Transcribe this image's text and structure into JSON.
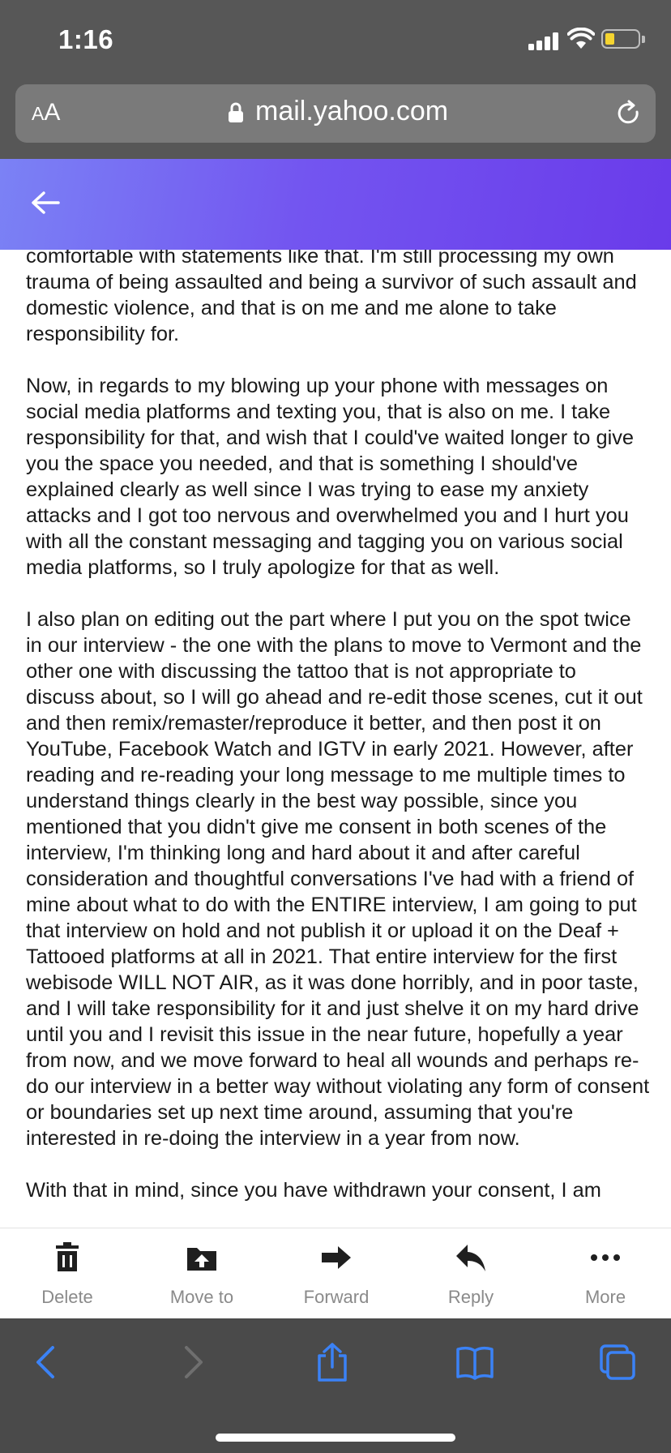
{
  "status_bar": {
    "time": "1:16"
  },
  "browser": {
    "aa_label_small": "A",
    "aa_label_large": "A",
    "url": "mail.yahoo.com"
  },
  "email": {
    "paragraphs": [
      "comfortable with statements like that. I'm still processing my own trauma of being assaulted and being a survivor of such assault and domestic violence, and that is on me and me alone to take responsibility for.",
      "Now, in regards to my blowing up your phone with messages on social media platforms and texting you, that is also on me. I take responsibility for that, and wish that I could've waited longer to give you the space you needed, and that is something I should've explained clearly as well since I was trying to ease my anxiety attacks and I got too nervous and overwhelmed you and I hurt you with all the constant messaging and tagging you on various social media platforms, so I truly apologize for that as well.",
      "I also plan on editing out the part where I put you on the spot twice in our interview - the one with the plans to move to Vermont and the other one with discussing the tattoo that is not appropriate to discuss about, so I will go ahead and re-edit those scenes, cut it out and then remix/remaster/reproduce it better, and then post it on YouTube, Facebook Watch and IGTV in early 2021. However, after reading and re-reading your long message to me multiple times to understand things clearly in the best way possible, since you mentioned that you didn't give me consent in both scenes of the interview, I'm thinking long and hard about it and after careful consideration and thoughtful conversations I've had with a friend of mine about what to do with the ENTIRE interview, I am going to put that interview on hold and not publish it or upload it on the Deaf + Tattooed platforms at all in 2021. That entire interview for the first webisode WILL NOT AIR, as it was done horribly, and in poor taste, and I will take responsibility for it and just shelve it on my hard drive until you and I revisit this issue in the near future, hopefully a year from now, and we move forward to heal all wounds and perhaps re-do our interview in a better way without violating any form of consent or boundaries set up next time around, assuming that you're interested in re-doing the interview in a year from now.",
      "With that in mind, since you have withdrawn your consent, I am"
    ]
  },
  "actions": {
    "delete": "Delete",
    "move_to": "Move to",
    "forward": "Forward",
    "reply": "Reply",
    "more": "More"
  },
  "colors": {
    "header_gradient_start": "#7b82f5",
    "header_gradient_end": "#6a3bea",
    "safari_icon_blue": "#3b82f6",
    "toolbar_bg": "#4a4a4a"
  }
}
